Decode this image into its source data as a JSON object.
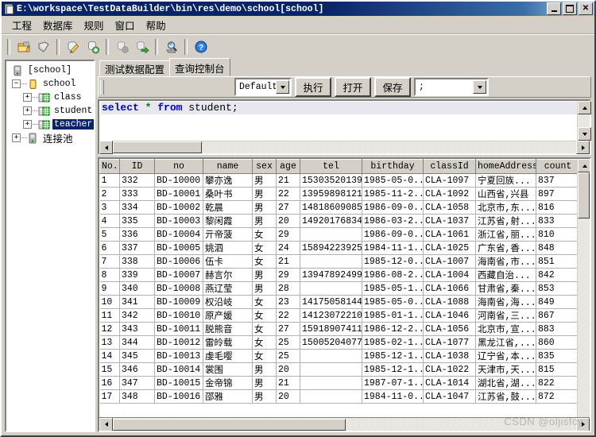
{
  "window": {
    "title": "E:\\workspace\\TestDataBuilder\\bin\\res\\demo\\school[school]",
    "minimize_label": "",
    "maximize_label": "",
    "close_label": "✕",
    "app_icon": "database-document-icon"
  },
  "menu": {
    "items": [
      {
        "label": "工程"
      },
      {
        "label": "数据库"
      },
      {
        "label": "规则"
      },
      {
        "label": "窗口"
      },
      {
        "label": "帮助"
      }
    ]
  },
  "toolbar": {
    "buttons": [
      {
        "icon": "open-folder-icon"
      },
      {
        "icon": "save-shield-icon"
      },
      {
        "icon": "edit-pencil-icon"
      },
      {
        "icon": "add-database-icon"
      },
      {
        "icon": "database-settings-icon"
      },
      {
        "icon": "database-export-icon"
      },
      {
        "icon": "search-data-icon"
      },
      {
        "icon": "help-question-icon"
      }
    ]
  },
  "tree": {
    "root": {
      "label": "[school]",
      "icon": "database-root-icon"
    },
    "nodes": [
      {
        "label": "school",
        "icon": "schema-icon",
        "expander": "−",
        "depth": 1,
        "selected": false
      },
      {
        "label": "class",
        "icon": "table-icon",
        "expander": "+",
        "depth": 2,
        "selected": false
      },
      {
        "label": "student",
        "icon": "table-icon",
        "expander": "+",
        "depth": 2,
        "selected": false
      },
      {
        "label": "teacher",
        "icon": "table-icon",
        "expander": "+",
        "depth": 2,
        "selected": true
      },
      {
        "label": "连接池",
        "icon": "connection-pool-icon",
        "expander": "+",
        "depth": 1,
        "selected": false
      }
    ]
  },
  "tabs": [
    {
      "label": "测试数据配置",
      "active": false
    },
    {
      "label": "查询控制台",
      "active": true
    }
  ],
  "query_bar": {
    "connection_select": {
      "value": "Default"
    },
    "execute_label": "执行",
    "open_label": "打开",
    "save_label": "保存",
    "delimiter_select": {
      "value": ";"
    }
  },
  "editor": {
    "tokens": [
      {
        "text": "select ",
        "type": "keyword"
      },
      {
        "text": "*",
        "type": "star"
      },
      {
        "text": " ",
        "type": "plain"
      },
      {
        "text": "from ",
        "type": "keyword"
      },
      {
        "text": "student;",
        "type": "plain"
      }
    ],
    "full_text": "select * from student;"
  },
  "grid": {
    "columns": [
      "No.",
      "ID",
      "no",
      "name",
      "sex",
      "age",
      "tel",
      "birthday",
      "classId",
      "homeAddress",
      "count"
    ],
    "rows": [
      [
        "1",
        "332",
        "BD-10000",
        "攀亦逸",
        "男",
        "21",
        "15303520139",
        "1985-05-0...",
        "CLA-1097",
        "宁夏回族...",
        "837"
      ],
      [
        "2",
        "333",
        "BD-10001",
        "桑叶书",
        "男",
        "22",
        "13959898121",
        "1985-11-2...",
        "CLA-1092",
        "山西省,兴县",
        "897"
      ],
      [
        "3",
        "334",
        "BD-10002",
        "乾晨",
        "男",
        "27",
        "14818609085",
        "1986-09-0...",
        "CLA-1058",
        "北京市,东...",
        "816"
      ],
      [
        "4",
        "335",
        "BD-10003",
        "黎闲霞",
        "男",
        "20",
        "14920176834",
        "1986-03-2...",
        "CLA-1037",
        "江苏省,射...",
        "833"
      ],
      [
        "5",
        "336",
        "BD-10004",
        "亓帝菠",
        "女",
        "29",
        "",
        "1986-09-0...",
        "CLA-1061",
        "浙江省,丽...",
        "810"
      ],
      [
        "6",
        "337",
        "BD-10005",
        "姚泗",
        "女",
        "24",
        "15894223925",
        "1984-11-1...",
        "CLA-1025",
        "广东省,香...",
        "848"
      ],
      [
        "7",
        "338",
        "BD-10006",
        "伍卡",
        "女",
        "21",
        "",
        "1985-12-0...",
        "CLA-1007",
        "海南省,市...",
        "851"
      ],
      [
        "8",
        "339",
        "BD-10007",
        "赫言尔",
        "男",
        "29",
        "13947892499",
        "1986-08-2...",
        "CLA-1004",
        "西藏自治...",
        "842"
      ],
      [
        "9",
        "340",
        "BD-10008",
        "燕辽莹",
        "男",
        "28",
        "",
        "1985-05-1...",
        "CLA-1066",
        "甘肃省,秦...",
        "853"
      ],
      [
        "10",
        "341",
        "BD-10009",
        "权沿岐",
        "女",
        "23",
        "14175058144",
        "1985-05-0...",
        "CLA-1088",
        "海南省,海...",
        "849"
      ],
      [
        "11",
        "342",
        "BD-10010",
        "原产媛",
        "女",
        "22",
        "14123072210",
        "1985-01-1...",
        "CLA-1046",
        "河南省,三...",
        "867"
      ],
      [
        "12",
        "343",
        "BD-10011",
        "脱熊音",
        "女",
        "27",
        "15918907411",
        "1986-12-2...",
        "CLA-1056",
        "北京市,宣...",
        "883"
      ],
      [
        "13",
        "344",
        "BD-10012",
        "雷皊载",
        "女",
        "25",
        "15005204077",
        "1985-02-1...",
        "CLA-1077",
        "黑龙江省,...",
        "860"
      ],
      [
        "14",
        "345",
        "BD-10013",
        "虔毛嘤",
        "女",
        "25",
        "",
        "1985-12-1...",
        "CLA-1038",
        "辽宁省,本...",
        "835"
      ],
      [
        "15",
        "346",
        "BD-10014",
        "裳围",
        "男",
        "20",
        "",
        "1985-12-1...",
        "CLA-1022",
        "天津市,天...",
        "815"
      ],
      [
        "16",
        "347",
        "BD-10015",
        "金帝锦",
        "男",
        "21",
        "",
        "1987-07-1...",
        "CLA-1014",
        "湖北省,湖...",
        "822"
      ],
      [
        "17",
        "348",
        "BD-10016",
        "邵雅",
        "男",
        "20",
        "",
        "1984-11-0...",
        "CLA-1047",
        "江苏省,鼓...",
        "872"
      ]
    ]
  },
  "watermark": {
    "text": "CSDN @oljisfcy"
  },
  "colors": {
    "titlebar_start": "#0a246a",
    "titlebar_end": "#a6caf0",
    "face": "#d4d0c8",
    "selection": "#0a246a",
    "keyword": "#0000d0",
    "star": "#008000"
  }
}
